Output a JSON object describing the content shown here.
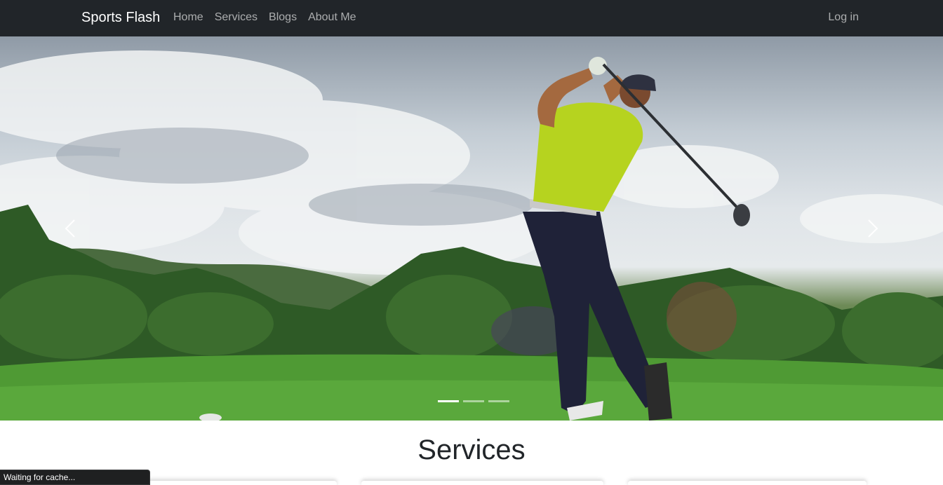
{
  "navbar": {
    "brand": "Sports Flash",
    "links": [
      "Home",
      "Services",
      "Blogs",
      "About Me"
    ],
    "login": "Log in"
  },
  "carousel": {
    "slide_count": 3,
    "active_slide": 1,
    "prev_icon": "chevron-left-icon",
    "next_icon": "chevron-right-icon"
  },
  "services": {
    "title": "Services"
  },
  "status": {
    "text": "Waiting for cache..."
  },
  "colors": {
    "navbar_bg": "#212529",
    "nav_link": "rgba(255,255,255,0.62)",
    "heading": "#212529"
  }
}
